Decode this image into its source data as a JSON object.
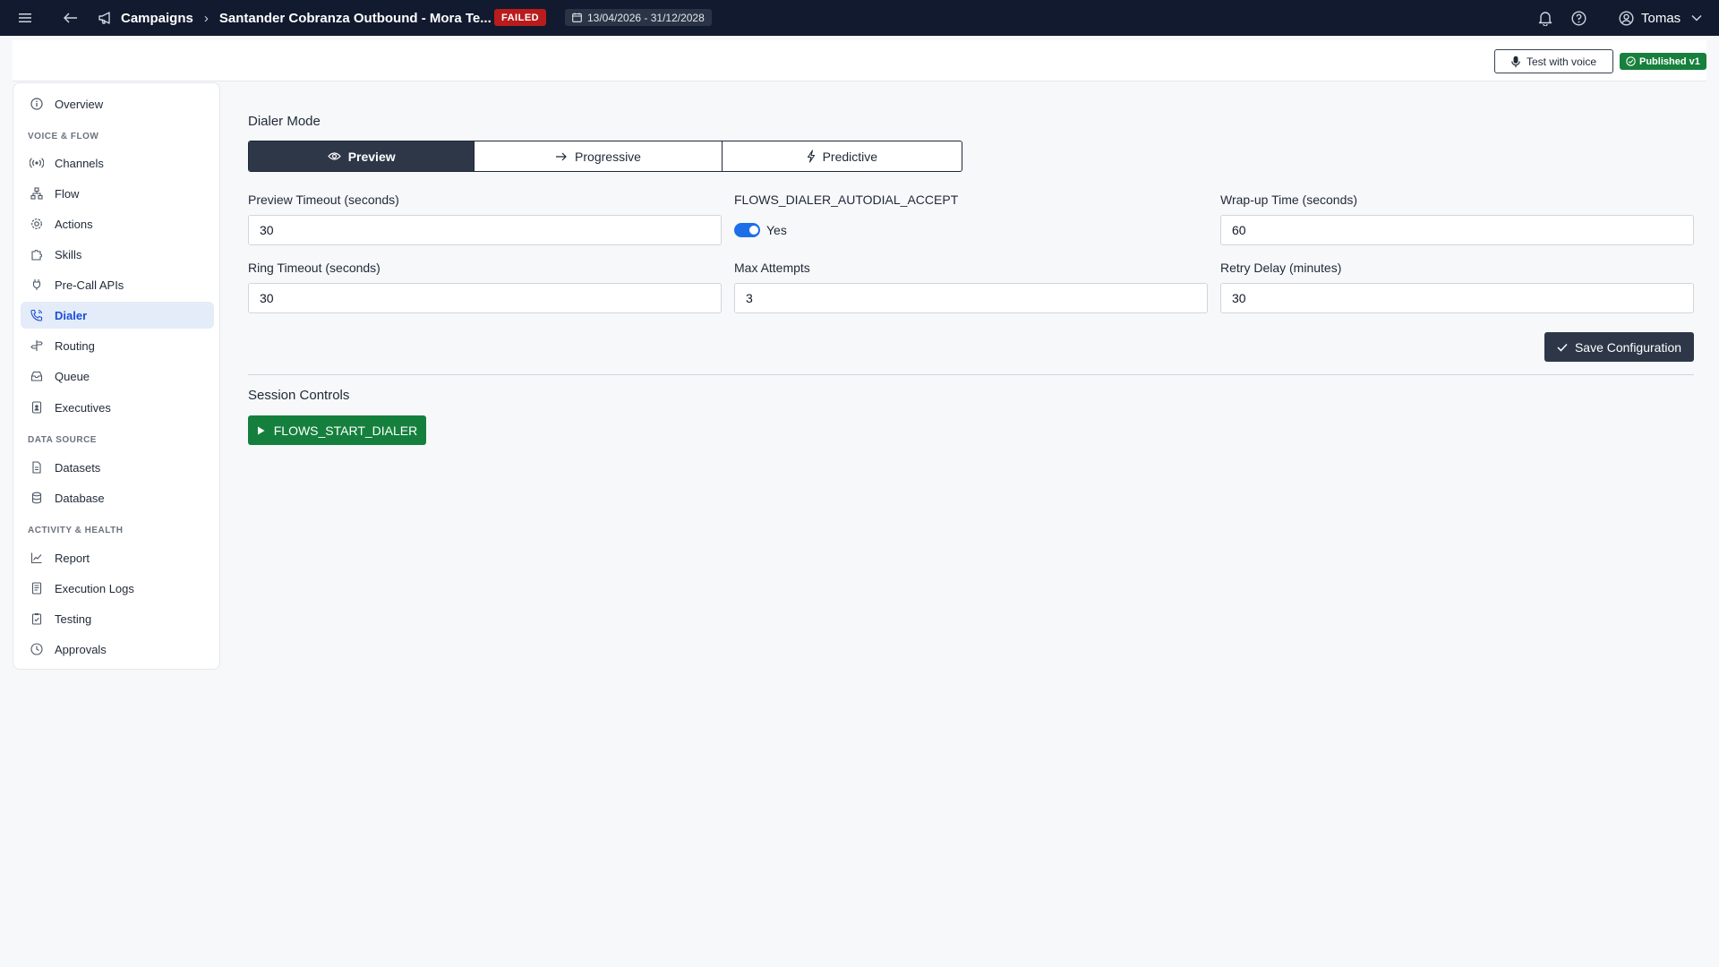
{
  "topbar": {
    "menu_icon": "hamburger-icon",
    "back_icon": "arrow-left-icon",
    "crumb_icon": "megaphone-icon",
    "breadcrumb_root": "Campaigns",
    "breadcrumb_sep": "›",
    "breadcrumb_current": "Santander Cobranza Outbound - Mora Te...",
    "status": "FAILED",
    "date_range": "13/04/2026 - 31/12/2028",
    "user_name": "Tomas"
  },
  "subheader": {
    "test_voice_label": "Test with voice",
    "published_label": "Published v1"
  },
  "sidebar": {
    "overview": "Overview",
    "section_voice": "VOICE & FLOW",
    "items_voice": [
      {
        "label": "Channels",
        "icon": "radio-signal-icon"
      },
      {
        "label": "Flow",
        "icon": "flow-icon"
      },
      {
        "label": "Actions",
        "icon": "gear-icon"
      },
      {
        "label": "Skills",
        "icon": "puzzle-icon"
      },
      {
        "label": "Pre-Call APIs",
        "icon": "plug-icon"
      },
      {
        "label": "Dialer",
        "icon": "phone-icon"
      },
      {
        "label": "Routing",
        "icon": "signpost-icon"
      },
      {
        "label": "Queue",
        "icon": "inbox-icon"
      },
      {
        "label": "Executives",
        "icon": "badge-icon"
      }
    ],
    "section_data": "DATA SOURCE",
    "items_data": [
      {
        "label": "Datasets",
        "icon": "file-icon"
      },
      {
        "label": "Database",
        "icon": "database-icon"
      }
    ],
    "section_activity": "ACTIVITY & HEALTH",
    "items_activity": [
      {
        "label": "Report",
        "icon": "chart-line-icon"
      },
      {
        "label": "Execution Logs",
        "icon": "log-icon"
      },
      {
        "label": "Testing",
        "icon": "clipboard-check-icon"
      },
      {
        "label": "Approvals",
        "icon": "clock-icon"
      }
    ]
  },
  "dialer": {
    "mode_label": "Dialer Mode",
    "modes": [
      "Preview",
      "Progressive",
      "Predictive"
    ],
    "active_mode": "Preview",
    "preview_timeout_label": "Preview Timeout (seconds)",
    "preview_timeout": "30",
    "autodial_label": "FLOWS_DIALER_AUTODIAL_ACCEPT",
    "autodial_value": "Yes",
    "wrapup_label": "Wrap-up Time (seconds)",
    "wrapup": "60",
    "ring_timeout_label": "Ring Timeout (seconds)",
    "ring_timeout": "30",
    "max_attempts_label": "Max Attempts",
    "max_attempts": "3",
    "retry_delay_label": "Retry Delay (minutes)",
    "retry_delay": "30",
    "save_label": "Save Configuration",
    "session_label": "Session Controls",
    "start_label": "FLOWS_START_DIALER"
  },
  "colors": {
    "topbar_bg": "#111a2e",
    "accent": "#1d4ed8",
    "failed": "#b91c1c",
    "published": "#16803c",
    "start": "#15803d",
    "dark_button": "#2d3748"
  }
}
